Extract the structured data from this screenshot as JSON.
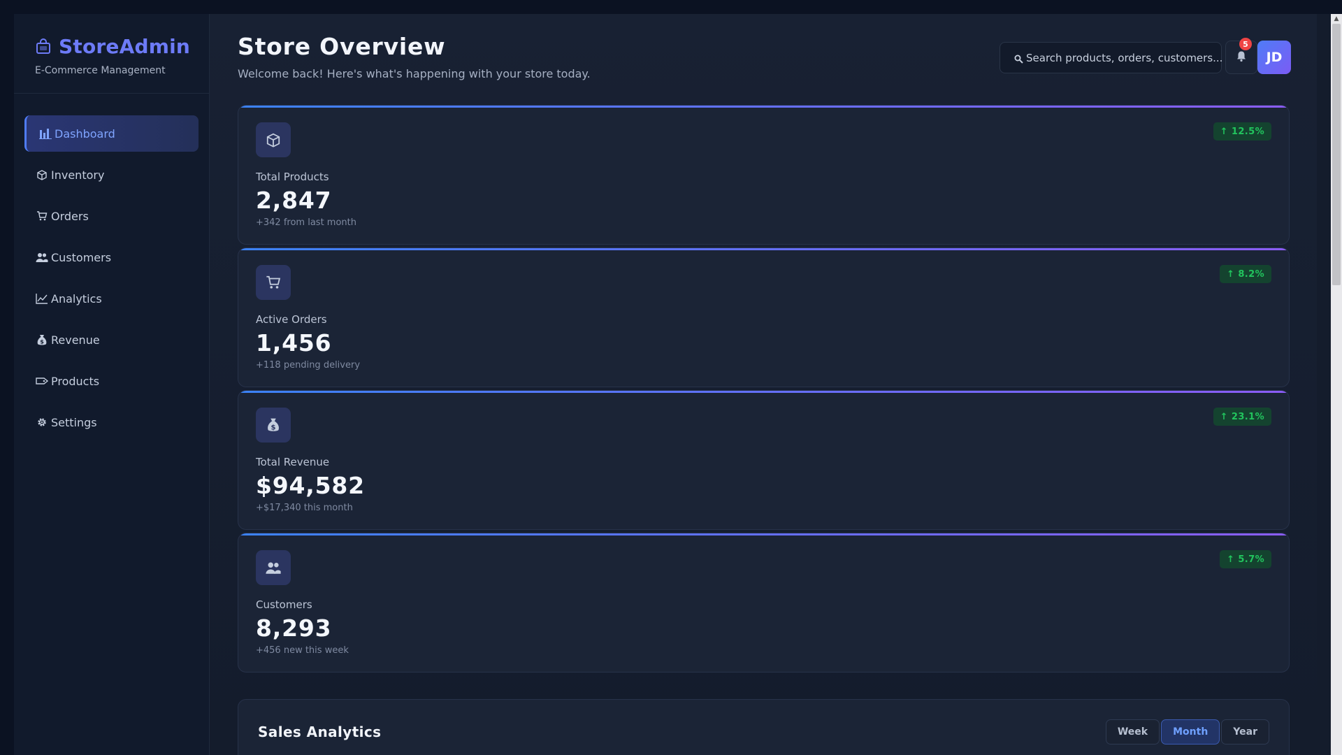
{
  "sidebar": {
    "brand_title": "StoreAdmin",
    "brand_subtitle": "E-Commerce Management",
    "items": [
      {
        "label": "Dashboard",
        "icon": "bar-chart-icon",
        "active": true
      },
      {
        "label": "Inventory",
        "icon": "package-icon"
      },
      {
        "label": "Orders",
        "icon": "cart-icon"
      },
      {
        "label": "Customers",
        "icon": "users-icon"
      },
      {
        "label": "Analytics",
        "icon": "line-chart-icon"
      },
      {
        "label": "Revenue",
        "icon": "money-bag-icon"
      },
      {
        "label": "Products",
        "icon": "tag-icon"
      },
      {
        "label": "Settings",
        "icon": "gear-icon"
      }
    ]
  },
  "header": {
    "title": "Store Overview",
    "subtitle": "Welcome back! Here's what's happening with your store today.",
    "search_placeholder": "Search products, orders, customers...",
    "notification_count": "5",
    "avatar_initials": "JD"
  },
  "stats": [
    {
      "label": "Total Products",
      "value": "2,847",
      "note": "+342 from last month",
      "trend": "↑ 12.5%",
      "icon": "package-icon"
    },
    {
      "label": "Active Orders",
      "value": "1,456",
      "note": "+118 pending delivery",
      "trend": "↑ 8.2%",
      "icon": "cart-icon"
    },
    {
      "label": "Total Revenue",
      "value": "$94,582",
      "note": "+$17,340 this month",
      "trend": "↑ 23.1%",
      "icon": "money-bag-icon"
    },
    {
      "label": "Customers",
      "value": "8,293",
      "note": "+456 new this week",
      "trend": "↑ 5.7%",
      "icon": "users-icon"
    }
  ],
  "sales": {
    "title": "Sales Analytics",
    "tabs": [
      {
        "label": "Week"
      },
      {
        "label": "Month",
        "active": true
      },
      {
        "label": "Year"
      }
    ]
  },
  "colors": {
    "accent": "#6d7bf7",
    "trend_positive": "#22c55e",
    "badge": "#ef4444"
  }
}
